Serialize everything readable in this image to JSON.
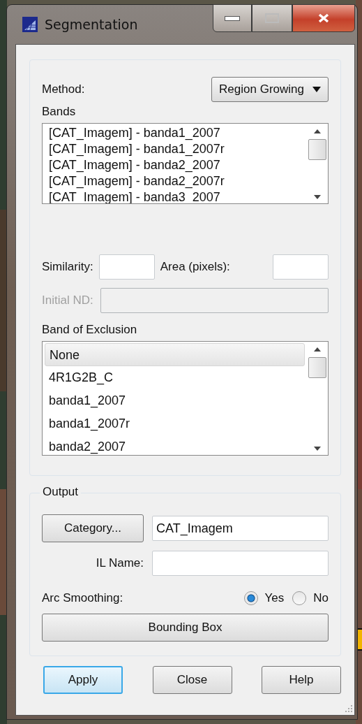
{
  "window": {
    "title": "Segmentation"
  },
  "method": {
    "label": "Method:",
    "value": "Region Growing"
  },
  "bands": {
    "label": "Bands",
    "items": [
      {
        "text": "[CAT_Imagem] - banda1_2007",
        "selected": false
      },
      {
        "text": "[CAT_Imagem] - banda1_2007r",
        "selected": false
      },
      {
        "text": "[CAT_Imagem] - banda2_2007",
        "selected": false
      },
      {
        "text": "[CAT_Imagem] - banda2_2007r",
        "selected": false
      },
      {
        "text": "[CAT_Imagem] - banda3_2007",
        "selected": false
      }
    ]
  },
  "similarity": {
    "label": "Similarity:"
  },
  "area": {
    "label": "Area (pixels):"
  },
  "initial_nd": {
    "label": "Initial ND:",
    "disabled": true
  },
  "exclusion": {
    "label": "Band of Exclusion",
    "items": [
      {
        "text": "None",
        "selected": true
      },
      {
        "text": "4R1G2B_C",
        "selected": false
      },
      {
        "text": "banda1_2007",
        "selected": false
      },
      {
        "text": "banda1_2007r",
        "selected": false
      },
      {
        "text": "banda2_2007",
        "selected": false
      }
    ]
  },
  "output": {
    "label": "Output",
    "category_button": "Category...",
    "category_value": "CAT_Imagem",
    "il_name_label": "IL Name:",
    "arc_smoothing": {
      "label": "Arc Smoothing:",
      "options": [
        {
          "label": "Yes",
          "selected": true
        },
        {
          "label": "No",
          "selected": false
        }
      ]
    },
    "bounding_box_button": "Bounding Box"
  },
  "buttons": [
    {
      "label": "Apply",
      "focused": true
    },
    {
      "label": "Close",
      "focused": false
    },
    {
      "label": "Help",
      "focused": false
    }
  ]
}
